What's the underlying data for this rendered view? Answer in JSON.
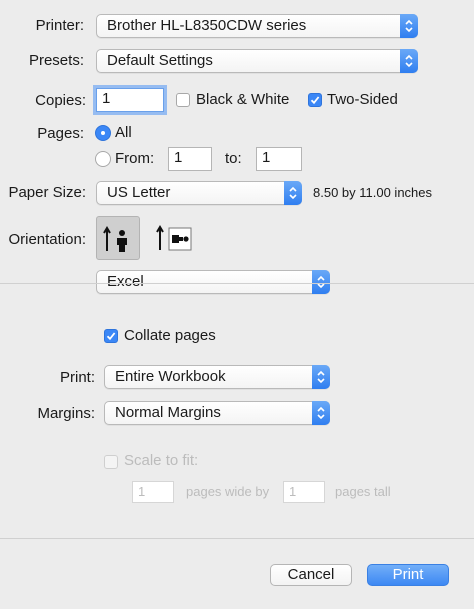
{
  "printer": {
    "label": "Printer:",
    "value": "Brother HL-L8350CDW series"
  },
  "presets": {
    "label": "Presets:",
    "value": "Default Settings"
  },
  "copies": {
    "label": "Copies:",
    "value": "1"
  },
  "black_white": {
    "label": "Black & White",
    "checked": false
  },
  "two_sided": {
    "label": "Two-Sided",
    "checked": true
  },
  "pages": {
    "label": "Pages:",
    "all_label": "All",
    "from_label": "From:",
    "from_value": "1",
    "to_label": "to:",
    "to_value": "1",
    "selected": "all"
  },
  "paper_size": {
    "label": "Paper Size:",
    "value": "US Letter",
    "dimensions": "8.50 by 11.00 inches"
  },
  "orientation": {
    "label": "Orientation:",
    "selected": "portrait",
    "options": [
      "portrait",
      "landscape"
    ]
  },
  "section_popup": {
    "value": "Excel"
  },
  "collate": {
    "label": "Collate pages",
    "checked": true
  },
  "print_scope": {
    "label": "Print:",
    "value": "Entire Workbook"
  },
  "margins": {
    "label": "Margins:",
    "value": "Normal Margins"
  },
  "scale_to_fit": {
    "label": "Scale to fit:",
    "enabled": false,
    "wide_value": "1",
    "wide_label": "pages wide by",
    "tall_value": "1",
    "tall_label": "pages tall"
  },
  "buttons": {
    "cancel": "Cancel",
    "print": "Print"
  },
  "colors": {
    "accent": "#3b87f6",
    "background": "#ececec"
  },
  "icons": {
    "popup_stepper": "up-down-chevrons-icon",
    "checkmark": "checkmark-icon",
    "portrait": "portrait-orientation-icon",
    "landscape": "landscape-orientation-icon"
  }
}
